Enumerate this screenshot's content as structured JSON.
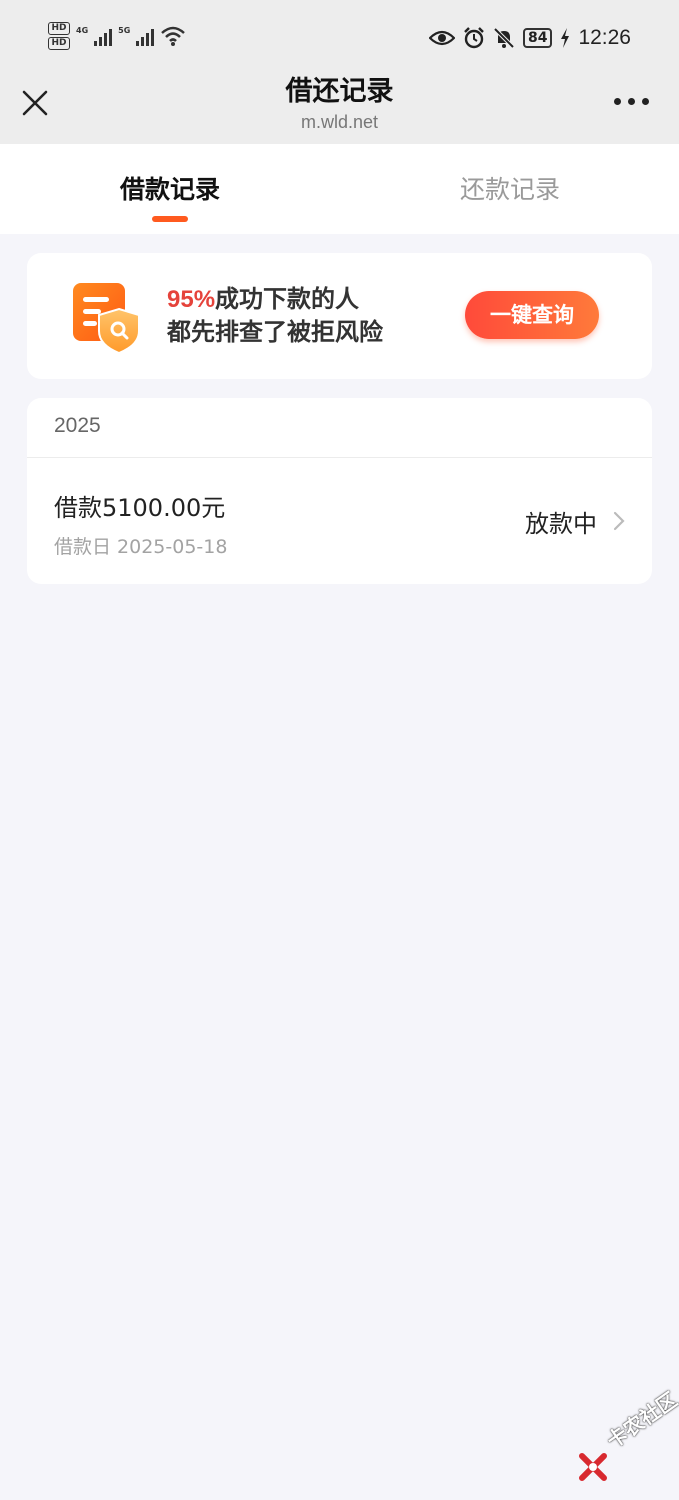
{
  "status_bar": {
    "hd1": "HD",
    "hd2": "HD",
    "net1": "4G",
    "net2": "5G",
    "battery": "84",
    "time": "12:26"
  },
  "nav": {
    "title": "借还记录",
    "subtitle": "m.wld.net"
  },
  "tabs": [
    {
      "label": "借款记录",
      "active": true
    },
    {
      "label": "还款记录",
      "active": false
    }
  ],
  "promo": {
    "highlight": "95%",
    "line1_rest": "成功下款的人",
    "line2": "都先排查了被拒风险",
    "button_label": "一键查询"
  },
  "records": {
    "year": "2025",
    "items": [
      {
        "amount": "借款5100.00元",
        "date": "借款日 2025-05-18",
        "status": "放款中"
      }
    ]
  },
  "watermark": {
    "text": "卡农社区"
  },
  "colors": {
    "accent": "#ff5a1f",
    "highlight_red": "#e5433b",
    "background": "#f5f5fa"
  }
}
